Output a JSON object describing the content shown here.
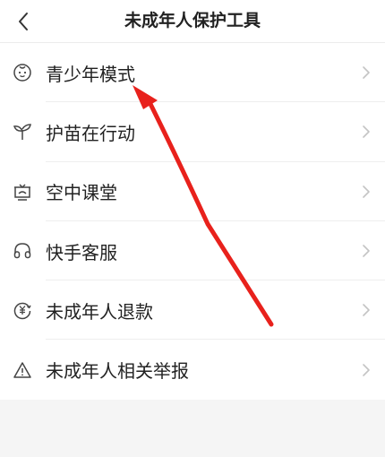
{
  "header": {
    "title": "未成年人保护工具",
    "back_icon": "chevron-left-icon"
  },
  "menu": {
    "items": [
      {
        "label": "青少年模式",
        "icon": "child-face-icon"
      },
      {
        "label": "护苗在行动",
        "icon": "sprout-icon"
      },
      {
        "label": "空中课堂",
        "icon": "classroom-icon"
      },
      {
        "label": "快手客服",
        "icon": "headset-icon"
      },
      {
        "label": "未成年人退款",
        "icon": "yuan-refund-icon"
      },
      {
        "label": "未成年人相关举报",
        "icon": "warning-icon"
      }
    ]
  },
  "colors": {
    "annotation_arrow": "#e8211c",
    "icon_stroke": "#444444",
    "chevron": "#c4c4c4",
    "background": "#f5f5f5"
  }
}
